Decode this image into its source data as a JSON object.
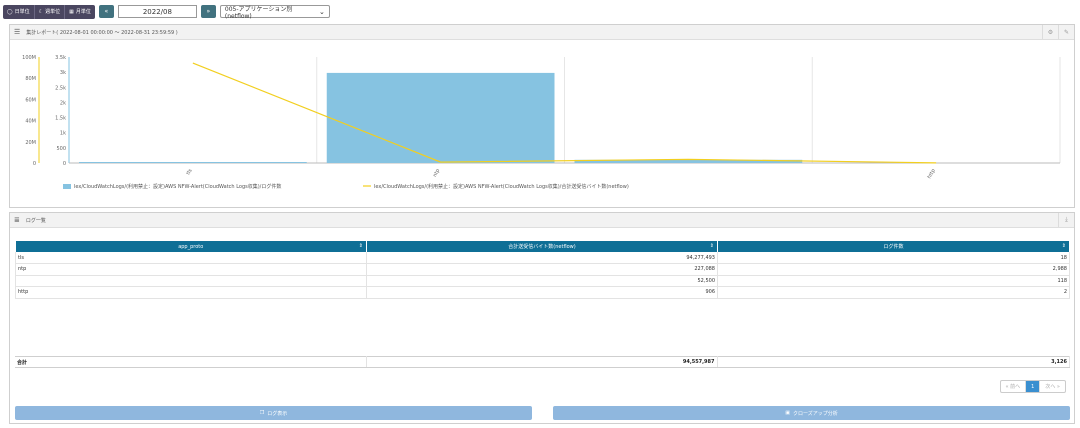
{
  "toolbar": {
    "day_label": "日単位",
    "week_label": "週単位",
    "month_label": "月単位",
    "prev_icon": "double-chevron-left-icon",
    "next_icon": "double-chevron-right-icon",
    "date_value": "2022/08",
    "report_select": "005-アプリケーション別(netflow)"
  },
  "chart_panel": {
    "title": "集計レポート( 2022-08-01 00:00:00 ～ 2022-08-31 23:59:59 )"
  },
  "chart_data": {
    "type": "bar+line",
    "categories": [
      "tls",
      "ntp",
      "",
      "http"
    ],
    "y_left_ticks": [
      "100M",
      "80M",
      "60M",
      "40M",
      "20M",
      "0"
    ],
    "y_right_ticks": [
      "3.5k",
      "3k",
      "2.5k",
      "2k",
      "1.5k",
      "1k",
      "500",
      "0"
    ],
    "ylim_left": [
      0,
      100000000
    ],
    "ylim_right": [
      0,
      3500
    ],
    "series": [
      {
        "name": "lex/CloudWatchLogs/(利用禁止：設定)AWS NFW-Alert(CloudWatch Logs収集)/ログ件数",
        "type": "bar",
        "axis": "left",
        "values": [
          4000,
          85000000,
          3000000,
          0
        ],
        "color": "#86c3e1"
      },
      {
        "name": "lex/CloudWatchLogs/(利用禁止：設定)AWS NFW-Alert(CloudWatch Logs収集)/合計送受信バイト数(netflow)",
        "type": "line",
        "axis": "right",
        "values": [
          3300,
          30,
          120,
          5
        ],
        "color": "#f2cf1f"
      }
    ],
    "legend_position": "bottom"
  },
  "log_panel": {
    "title": "ログ一覧",
    "columns": [
      "app_proto",
      "合計送受信バイト数(netflow)",
      "ログ件数"
    ],
    "rows": [
      [
        "tls",
        "94,277,493",
        "18"
      ],
      [
        "ntp",
        "227,088",
        "2,988"
      ],
      [
        "",
        "52,500",
        "118"
      ],
      [
        "http",
        "906",
        "2"
      ]
    ],
    "total": {
      "label": "合計",
      "bytes": "94,557,987",
      "count": "3,126"
    },
    "pager": {
      "prev": "« 前へ",
      "page": "1",
      "next": "次へ »"
    },
    "log_view_button": "ログ表示",
    "closeup_button": "クローズアップ分析"
  }
}
